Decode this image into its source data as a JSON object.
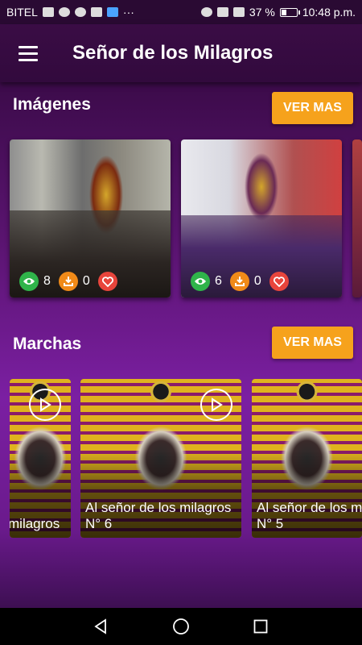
{
  "status_bar": {
    "carrier": "BITEL",
    "battery": "37 %",
    "battery_level": 0.37,
    "time": "10:48 p.m.",
    "more": "···"
  },
  "app_bar": {
    "title": "Señor de los Milagros",
    "menu_icon": "hamburger-menu-icon"
  },
  "imagenes": {
    "title": "Imágenes",
    "button_label": "VER MAS",
    "cards": [
      {
        "views": "8",
        "downloads": "0"
      },
      {
        "views": "6",
        "downloads": "0"
      }
    ]
  },
  "marchas": {
    "title": "Marchas",
    "button_label": "VER MAS",
    "cards": [
      {
        "label_line1": "milagros",
        "label_line2": ""
      },
      {
        "label_line1": "Al señor de los milagros",
        "label_line2": "N° 6"
      },
      {
        "label_line1": "Al señor de los milagros",
        "label_line2": "N° 5"
      }
    ]
  },
  "colors": {
    "accent": "#f6a21c",
    "app_bar": "#3a0c45",
    "views_icon": "#2fb44a",
    "downloads_icon": "#f08a18",
    "like_icon": "#e8453c"
  },
  "nav_bar": {
    "back_icon": "back-triangle-icon",
    "home_icon": "home-circle-icon",
    "recents_icon": "recents-square-icon"
  }
}
